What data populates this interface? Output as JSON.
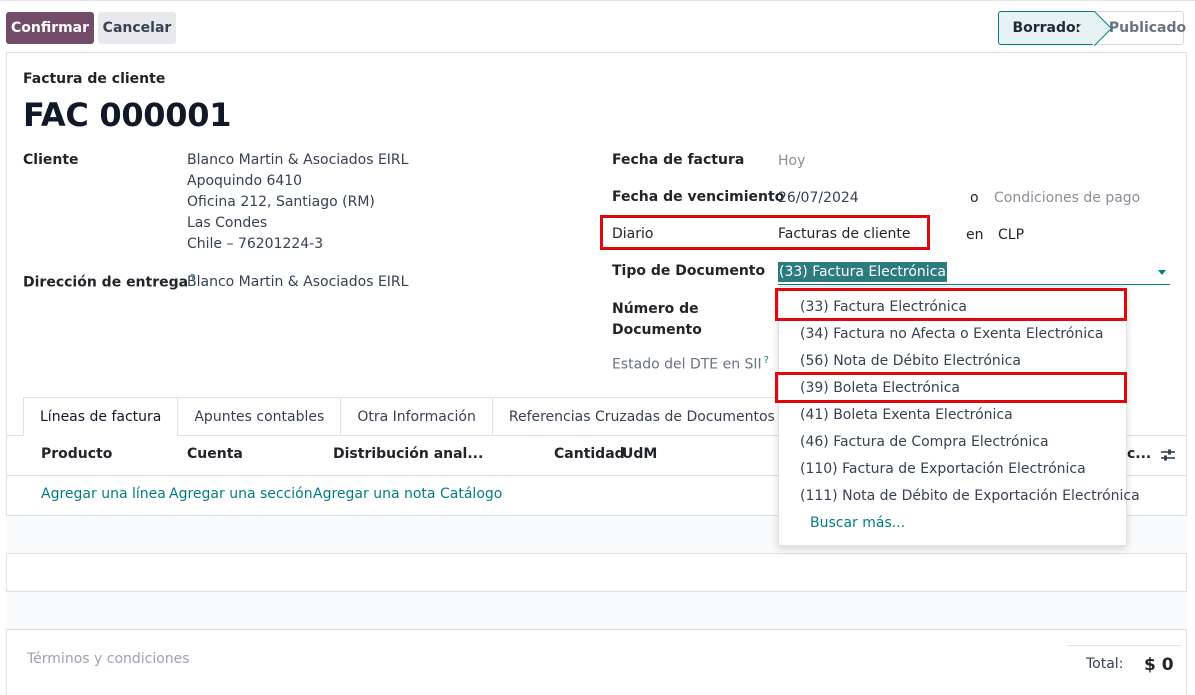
{
  "toolbar": {
    "confirm_label": "Confirmar",
    "cancel_label": "Cancelar"
  },
  "status": {
    "draft": "Borrador",
    "posted": "Publicado",
    "active": "Borrador"
  },
  "form": {
    "subtitle": "Factura de cliente",
    "title": "FAC 000001",
    "customer_label": "Cliente",
    "customer_address": [
      "Blanco Martin & Asociados EIRL",
      "Apoquindo 6410",
      "Oficina 212, Santiago (RM)",
      "Las Condes",
      "Chile – 76201224-3"
    ],
    "delivery_label": "Dirección de entrega",
    "delivery_help": "?",
    "delivery_value": "Blanco Martin & Asociados EIRL",
    "invoice_date_label": "Fecha de factura",
    "invoice_date_value": "Hoy",
    "due_date_label": "Fecha de vencimiento",
    "due_date_value": "26/07/2024",
    "due_or": "o",
    "payment_terms_placeholder": "Condiciones de pago",
    "journal_label": "Diario",
    "journal_value": "Facturas de cliente",
    "currency_in": "en",
    "currency_value": "CLP",
    "doc_type_label": "Tipo de Documento",
    "doc_type_value": "(33) Factura Electrónica",
    "doc_number_label_1": "Número de",
    "doc_number_label_2": "Documento",
    "dte_status_label": "Estado del DTE en SII",
    "dte_help": "?"
  },
  "dropdown": {
    "items": [
      "(33) Factura Electrónica",
      "(34) Factura no Afecta o Exenta Electrónica",
      "(56) Nota de Débito Electrónica",
      "(39) Boleta Electrónica",
      "(41) Boleta Exenta Electrónica",
      "(46) Factura de Compra Electrónica",
      "(110) Factura de Exportación Electrónica",
      "(111) Nota de Débito de Exportación Electrónica"
    ],
    "search_more": "Buscar más..."
  },
  "tabs": [
    "Líneas de factura",
    "Apuntes contables",
    "Otra Información",
    "Referencias Cruzadas de Documentos"
  ],
  "table": {
    "headers": {
      "product": "Producto",
      "account": "Cuenta",
      "analytic": "Distribución anal...",
      "quantity": "Cantidad",
      "uom": "UdM",
      "truncated": "c..."
    },
    "actions": [
      "Agregar una línea",
      "Agregar una sección",
      "Agregar una nota",
      "Catálogo"
    ]
  },
  "footer": {
    "terms_placeholder": "Términos y condiciones",
    "total_label": "Total:",
    "total_value": "$ 0"
  },
  "colors": {
    "primary": "#714b67",
    "accent": "#017e84",
    "highlight": "#e0070d"
  }
}
